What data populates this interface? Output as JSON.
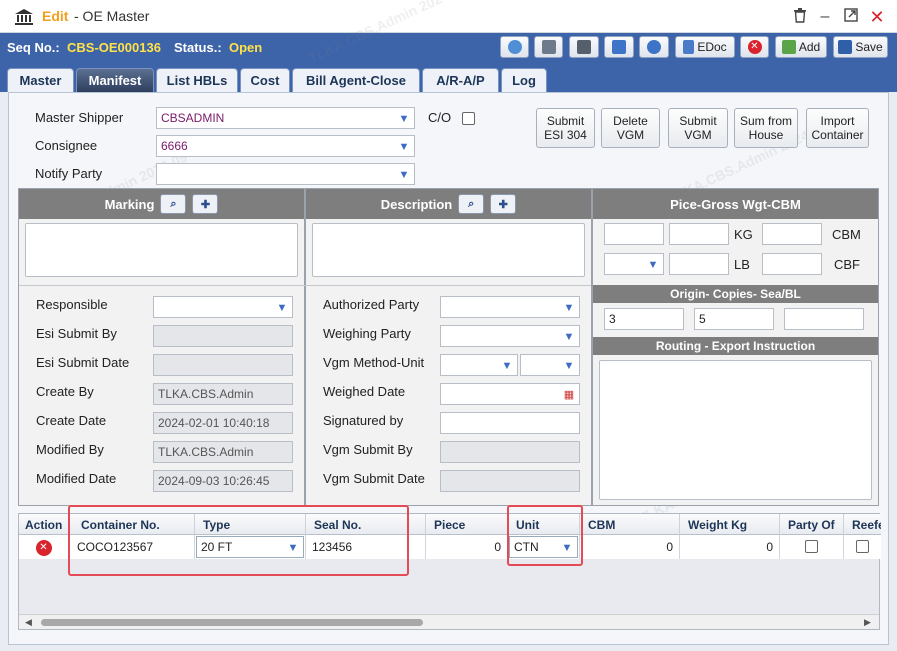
{
  "window": {
    "mode": "Edit",
    "title": "- OE Master"
  },
  "toolbar": {
    "seq_label": "Seq No.:",
    "seq_value": "CBS-OE000136",
    "status_label": "Status.:",
    "status_value": "Open",
    "edoc_label": "EDoc",
    "add_label": "Add",
    "save_label": "Save"
  },
  "tabs": [
    "Master",
    "Manifest",
    "List HBLs",
    "Cost",
    "Bill Agent-Close",
    "A/R-A/P",
    "Log"
  ],
  "active_tab": "Manifest",
  "parties": {
    "master_shipper_label": "Master Shipper",
    "master_shipper_value": "CBSADMIN",
    "consignee_label": "Consignee",
    "consignee_value": "6666",
    "notify_label": "Notify Party",
    "notify_value": "",
    "co_label": "C/O"
  },
  "actions": {
    "submit_esi": "Submit ESI 304",
    "delete_vgm": "Delete VGM",
    "submit_vgm": "Submit VGM",
    "sum_house": "Sum from House",
    "import_container": "Import Container"
  },
  "marking": {
    "title": "Marking"
  },
  "description": {
    "title": "Description"
  },
  "pice": {
    "title": "Pice-Gross Wgt-CBM",
    "kg_label": "KG",
    "cbm_label": "CBM",
    "lb_label": "LB",
    "cbf_label": "CBF",
    "origin_title": "Origin- Copies- Sea/BL",
    "origin_1": "3",
    "origin_2": "5",
    "origin_3": "",
    "routing_title": "Routing - Export Instruction"
  },
  "left_fields": {
    "responsible": "Responsible",
    "esi_submit_by": "Esi Submit By",
    "esi_submit_date": "Esi Submit Date",
    "create_by": "Create By",
    "create_by_value": "TLKA.CBS.Admin",
    "create_date": "Create Date",
    "create_date_value": "2024-02-01 10:40:18",
    "modified_by": "Modified By",
    "modified_by_value": "TLKA.CBS.Admin",
    "modified_date": "Modified Date",
    "modified_date_value": "2024-09-03 10:26:45"
  },
  "mid_fields": {
    "authorized_party": "Authorized Party",
    "weighing_party": "Weighing Party",
    "vgm_method_unit": "Vgm Method-Unit",
    "weighed_date": "Weighed Date",
    "signatured_by": "Signatured by",
    "vgm_submit_by": "Vgm Submit By",
    "vgm_submit_date": "Vgm Submit Date"
  },
  "grid": {
    "headers": [
      "Action",
      "Container No.",
      "Type",
      "Seal No.",
      "Piece",
      "Unit",
      "CBM",
      "Weight Kg",
      "Party Of",
      "Reefe"
    ],
    "row": {
      "container_no": "COCO123567",
      "type": "20 FT",
      "seal_no": "123456",
      "piece": "0",
      "unit": "CTN",
      "cbm": "0",
      "weight": "0"
    }
  },
  "watermark": "TLKA.CBS.Admin 2024-09-03",
  "colors": {
    "header_blue": "#3d63a8",
    "status_yellow": "#ffe24a",
    "edit_orange": "#f0a020",
    "highlight_red": "#e34b56"
  }
}
